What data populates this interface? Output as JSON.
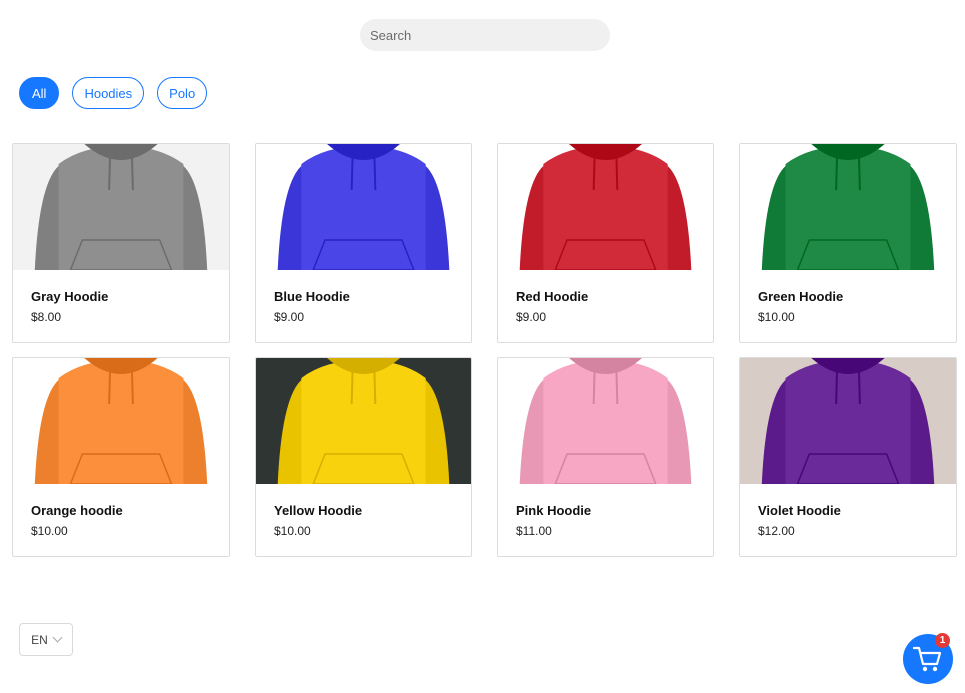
{
  "search": {
    "placeholder": "Search"
  },
  "filters": [
    {
      "label": "All",
      "active": true
    },
    {
      "label": "Hoodies",
      "active": false
    },
    {
      "label": "Polo",
      "active": false
    }
  ],
  "products": [
    {
      "name": "Gray Hoodie",
      "price": "$8.00",
      "color": "#8f8f8f",
      "bg": "#f2f2f2"
    },
    {
      "name": "Blue Hoodie",
      "price": "$9.00",
      "color": "#4a45e6",
      "bg": "#ffffff"
    },
    {
      "name": "Red Hoodie",
      "price": "$9.00",
      "color": "#d12b3a",
      "bg": "#ffffff"
    },
    {
      "name": "Green Hoodie",
      "price": "$10.00",
      "color": "#1f8a45",
      "bg": "#ffffff"
    },
    {
      "name": "Orange hoodie",
      "price": "$10.00",
      "color": "#fb8f3c",
      "bg": "#ffffff"
    },
    {
      "name": "Yellow Hoodie",
      "price": "$10.00",
      "color": "#f8d20c",
      "bg": "#2f3532"
    },
    {
      "name": "Pink Hoodie",
      "price": "$11.00",
      "color": "#f7a6c4",
      "bg": "#ffffff"
    },
    {
      "name": "Violet Hoodie",
      "price": "$12.00",
      "color": "#6b2a99",
      "bg": "#d7ccc6"
    }
  ],
  "language": {
    "value": "EN"
  },
  "cart": {
    "count": "1",
    "icon": "cart-icon"
  },
  "colors": {
    "accent": "#1677ff",
    "badge": "#e53935"
  }
}
